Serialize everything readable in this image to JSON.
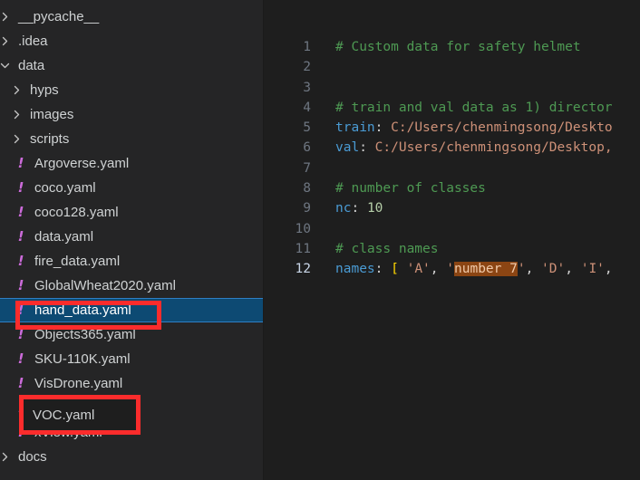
{
  "colors": {
    "sidebar_bg": "#252526",
    "editor_bg": "#1e1e1e",
    "selection_blue": "#0d4a73",
    "selection_border": "#2f7fc4",
    "annotation_red": "#fb2c2c",
    "yaml_icon": "#cb6bd9",
    "comment_green": "#4e9a53",
    "key_blue": "#4a9bd4",
    "string_orange": "#ce9178",
    "number_green": "#b5cea8",
    "bracket_yellow": "#ffd700",
    "search_highlight": "#8b4513"
  },
  "explorer": {
    "items": [
      {
        "label": "__pycache__",
        "kind": "folder",
        "icon": "chevron-right-icon",
        "indent": 0,
        "selected": false
      },
      {
        "label": ".idea",
        "kind": "folder",
        "icon": "chevron-right-icon",
        "indent": 0,
        "selected": false
      },
      {
        "label": "data",
        "kind": "folder",
        "icon": "chevron-down-icon",
        "indent": 0,
        "selected": false
      },
      {
        "label": "hyps",
        "kind": "folder",
        "icon": "chevron-right-icon",
        "indent": 1,
        "selected": false
      },
      {
        "label": "images",
        "kind": "folder",
        "icon": "chevron-right-icon",
        "indent": 1,
        "selected": false
      },
      {
        "label": "scripts",
        "kind": "folder",
        "icon": "chevron-right-icon",
        "indent": 1,
        "selected": false
      },
      {
        "label": "Argoverse.yaml",
        "kind": "file",
        "icon": "yaml-file-icon",
        "indent": 1,
        "selected": false
      },
      {
        "label": "coco.yaml",
        "kind": "file",
        "icon": "yaml-file-icon",
        "indent": 1,
        "selected": false
      },
      {
        "label": "coco128.yaml",
        "kind": "file",
        "icon": "yaml-file-icon",
        "indent": 1,
        "selected": false
      },
      {
        "label": "data.yaml",
        "kind": "file",
        "icon": "yaml-file-icon",
        "indent": 1,
        "selected": false
      },
      {
        "label": "fire_data.yaml",
        "kind": "file",
        "icon": "yaml-file-icon",
        "indent": 1,
        "selected": false
      },
      {
        "label": "GlobalWheat2020.yaml",
        "kind": "file",
        "icon": "yaml-file-icon",
        "indent": 1,
        "selected": false
      },
      {
        "label": "hand_data.yaml",
        "kind": "file",
        "icon": "yaml-file-icon",
        "indent": 1,
        "selected": true
      },
      {
        "label": "Objects365.yaml",
        "kind": "file",
        "icon": "yaml-file-icon",
        "indent": 1,
        "selected": false
      },
      {
        "label": "SKU-110K.yaml",
        "kind": "file",
        "icon": "yaml-file-icon",
        "indent": 1,
        "selected": false
      },
      {
        "label": "VisDrone.yaml",
        "kind": "file",
        "icon": "yaml-file-icon",
        "indent": 1,
        "selected": false
      },
      {
        "label": "VOC.yaml",
        "kind": "file",
        "icon": "yaml-file-icon",
        "indent": 1,
        "selected": false
      },
      {
        "label": "xView.yaml",
        "kind": "file",
        "icon": "yaml-file-icon",
        "indent": 1,
        "selected": false
      },
      {
        "label": "docs",
        "kind": "folder",
        "icon": "chevron-right-icon",
        "indent": 0,
        "selected": false
      }
    ]
  },
  "editor": {
    "active_line": 12,
    "lines": [
      {
        "n": "1",
        "tokens": [
          {
            "t": "# Custom data for safety helmet",
            "c": "tok-comment"
          }
        ]
      },
      {
        "n": "2",
        "tokens": []
      },
      {
        "n": "3",
        "tokens": []
      },
      {
        "n": "4",
        "tokens": [
          {
            "t": "# train and val data as 1) director",
            "c": "tok-comment"
          }
        ]
      },
      {
        "n": "5",
        "tokens": [
          {
            "t": "train",
            "c": "tok-key"
          },
          {
            "t": ": ",
            "c": "tok-punct"
          },
          {
            "t": "C:/Users/chenmingsong/Deskto",
            "c": "tok-str"
          }
        ]
      },
      {
        "n": "6",
        "tokens": [
          {
            "t": "val",
            "c": "tok-key"
          },
          {
            "t": ": ",
            "c": "tok-punct"
          },
          {
            "t": "C:/Users/chenmingsong/Desktop,",
            "c": "tok-str"
          }
        ]
      },
      {
        "n": "7",
        "tokens": []
      },
      {
        "n": "8",
        "tokens": [
          {
            "t": "# number of classes",
            "c": "tok-comment"
          }
        ]
      },
      {
        "n": "9",
        "tokens": [
          {
            "t": "nc",
            "c": "tok-key"
          },
          {
            "t": ": ",
            "c": "tok-punct"
          },
          {
            "t": "10",
            "c": "tok-num"
          }
        ]
      },
      {
        "n": "10",
        "tokens": []
      },
      {
        "n": "11",
        "tokens": [
          {
            "t": "# class names",
            "c": "tok-comment"
          }
        ]
      },
      {
        "n": "12",
        "tokens": [
          {
            "t": "names",
            "c": "tok-key"
          },
          {
            "t": ": ",
            "c": "tok-punct"
          },
          {
            "t": "[",
            "c": "tok-bracket"
          },
          {
            "t": " ",
            "c": "tok-punct"
          },
          {
            "t": "'A'",
            "c": "tok-str"
          },
          {
            "t": ", ",
            "c": "tok-punct"
          },
          {
            "t": "'",
            "c": "tok-str"
          },
          {
            "t": "number 7",
            "c": "tok-sel"
          },
          {
            "t": "'",
            "c": "tok-str"
          },
          {
            "t": ", ",
            "c": "tok-punct"
          },
          {
            "t": "'D'",
            "c": "tok-str"
          },
          {
            "t": ", ",
            "c": "tok-punct"
          },
          {
            "t": "'I'",
            "c": "tok-str"
          },
          {
            "t": ",",
            "c": "tok-punct"
          }
        ]
      }
    ]
  },
  "annotations": {
    "hand_data_box": {
      "target": "hand_data.yaml"
    },
    "voc_box": {
      "target": "VOC.yaml",
      "label": "VOC.yaml"
    }
  }
}
